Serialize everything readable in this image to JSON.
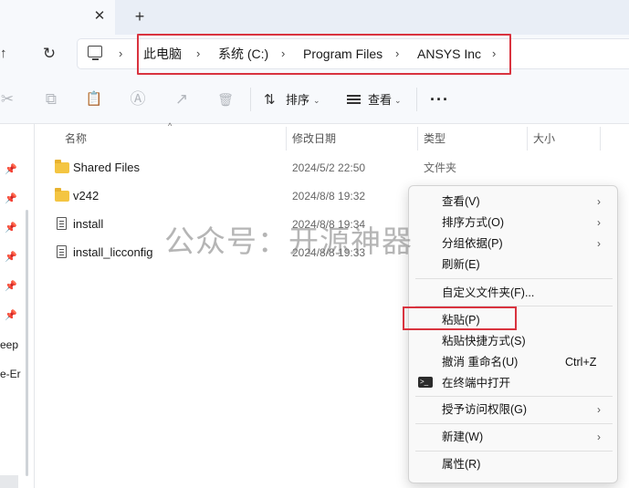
{
  "tab": {
    "close_glyph": "✕",
    "new_glyph": "+"
  },
  "nav": {
    "up_glyph": "↑",
    "refresh_glyph": "↻"
  },
  "breadcrumb": {
    "items": [
      "此电脑",
      "系统 (C:)",
      "Program Files",
      "ANSYS Inc"
    ],
    "separator": "›"
  },
  "toolbar": {
    "cut_icon": "✂",
    "copy_icon": "⧉",
    "paste_icon": "📋",
    "rename_icon": "Ⓐ",
    "share_icon": "↗",
    "delete_icon": "🗑",
    "sort_label": "排序",
    "view_label": "查看",
    "chevron": "⌄",
    "more": "···",
    "sort_glyph": "⇅"
  },
  "navpane": {
    "pin_glyph": "📌",
    "cut_labels": [
      "eep",
      "e-Er"
    ]
  },
  "columns": {
    "name": "名称",
    "modified": "修改日期",
    "type": "类型",
    "size": "大小",
    "sort_caret": "^"
  },
  "files": [
    {
      "name": "Shared Files",
      "date": "2024/5/2 22:50",
      "type": "文件夹",
      "kind": "folder"
    },
    {
      "name": "v242",
      "date": "2024/8/8 19:32",
      "type": "",
      "kind": "folder"
    },
    {
      "name": "install",
      "date": "2024/8/8 19:34",
      "type": "",
      "kind": "file"
    },
    {
      "name": "install_licconfig",
      "date": "2024/8/8 19:33",
      "type": "",
      "kind": "file"
    }
  ],
  "watermark": "公众号：开源神器",
  "context_menu": {
    "items": [
      {
        "label": "查看(V)",
        "arrow": "›"
      },
      {
        "label": "排序方式(O)",
        "arrow": "›"
      },
      {
        "label": "分组依据(P)",
        "arrow": "›"
      },
      {
        "label": "刷新(E)"
      },
      {
        "label": "自定义文件夹(F)..."
      },
      {
        "label": "粘贴(P)"
      },
      {
        "label": "粘贴快捷方式(S)"
      },
      {
        "label": "撤消 重命名(U)",
        "shortcut": "Ctrl+Z"
      },
      {
        "label": "在终端中打开",
        "icon": "terminal-icon"
      },
      {
        "label": "授予访问权限(G)",
        "arrow": "›"
      },
      {
        "label": "新建(W)",
        "arrow": "›"
      },
      {
        "label": "属性(R)"
      }
    ]
  },
  "colors": {
    "highlight": "#d9333f",
    "folder": "#f4c542"
  }
}
